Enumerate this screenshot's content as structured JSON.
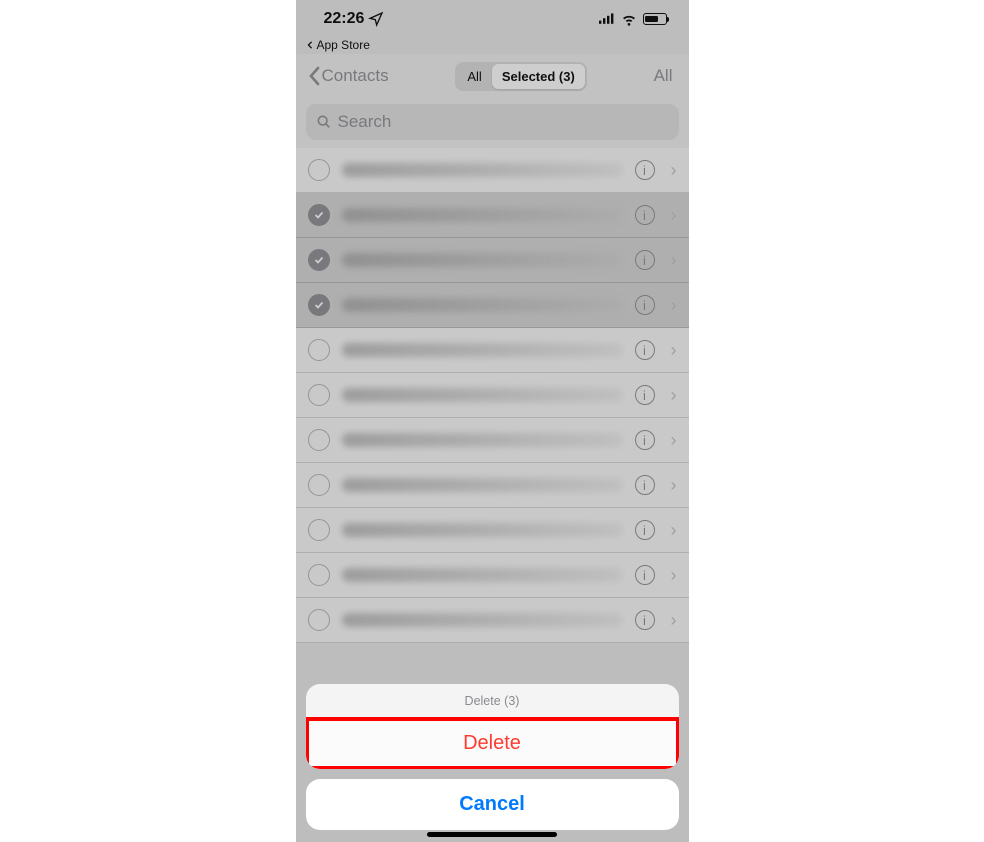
{
  "statusbar": {
    "time": "22:26",
    "backlink": "App Store"
  },
  "nav": {
    "back": "Contacts",
    "seg_all": "All",
    "seg_selected": "Selected (3)",
    "right": "All"
  },
  "search": {
    "placeholder": "Search"
  },
  "contacts": [
    {
      "selected": false,
      "len": "med"
    },
    {
      "selected": true,
      "len": "vshort"
    },
    {
      "selected": true,
      "len": "short"
    },
    {
      "selected": true,
      "len": "short"
    },
    {
      "selected": false,
      "len": "long"
    },
    {
      "selected": false,
      "len": "med"
    },
    {
      "selected": false,
      "len": "vshort"
    },
    {
      "selected": false,
      "len": "med"
    },
    {
      "selected": false,
      "len": "med"
    },
    {
      "selected": false,
      "len": "long"
    },
    {
      "selected": false,
      "len": "med"
    }
  ],
  "sheet": {
    "title": "Delete (3)",
    "delete": "Delete",
    "cancel": "Cancel"
  }
}
